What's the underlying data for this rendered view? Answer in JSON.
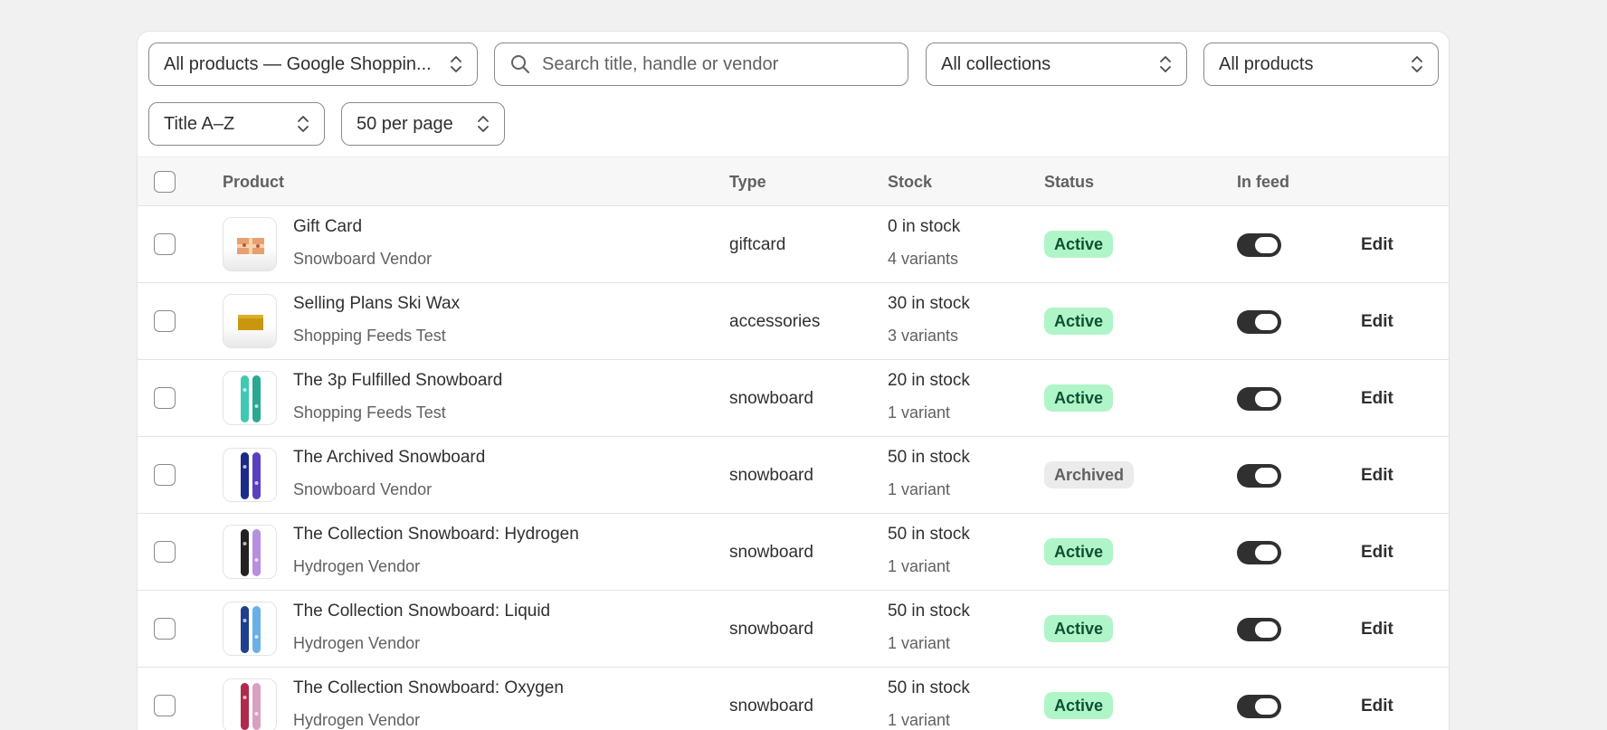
{
  "filters": {
    "feed_select": "All products — Google Shoppin...",
    "search_placeholder": "Search title, handle or vendor",
    "collections_select": "All collections",
    "products_select": "All products",
    "sort_select": "Title A–Z",
    "per_page_select": "50 per page"
  },
  "table": {
    "headers": {
      "product": "Product",
      "type": "Type",
      "stock": "Stock",
      "status": "Status",
      "in_feed": "In feed"
    },
    "edit_label": "Edit",
    "rows": [
      {
        "name": "Gift Card",
        "vendor": "Snowboard Vendor",
        "type": "giftcard",
        "stock": "0 in stock",
        "variants": "4 variants",
        "status": "Active",
        "in_feed": true,
        "thumb_icon": "gift-card-icon"
      },
      {
        "name": "Selling Plans Ski Wax",
        "vendor": "Shopping Feeds Test",
        "type": "accessories",
        "stock": "30 in stock",
        "variants": "3 variants",
        "status": "Active",
        "in_feed": true,
        "thumb_icon": "ski-wax-icon"
      },
      {
        "name": "The 3p Fulfilled Snowboard",
        "vendor": "Shopping Feeds Test",
        "type": "snowboard",
        "stock": "20 in stock",
        "variants": "1 variant",
        "status": "Active",
        "in_feed": true,
        "thumb_icon": "snowboard-icon"
      },
      {
        "name": "The Archived Snowboard",
        "vendor": "Snowboard Vendor",
        "type": "snowboard",
        "stock": "50 in stock",
        "variants": "1 variant",
        "status": "Archived",
        "in_feed": true,
        "thumb_icon": "snowboard-icon"
      },
      {
        "name": "The Collection Snowboard: Hydrogen",
        "vendor": "Hydrogen Vendor",
        "type": "snowboard",
        "stock": "50 in stock",
        "variants": "1 variant",
        "status": "Active",
        "in_feed": true,
        "thumb_icon": "snowboard-icon"
      },
      {
        "name": "The Collection Snowboard: Liquid",
        "vendor": "Hydrogen Vendor",
        "type": "snowboard",
        "stock": "50 in stock",
        "variants": "1 variant",
        "status": "Active",
        "in_feed": true,
        "thumb_icon": "snowboard-icon"
      },
      {
        "name": "The Collection Snowboard: Oxygen",
        "vendor": "Hydrogen Vendor",
        "type": "snowboard",
        "stock": "50 in stock",
        "variants": "1 variant",
        "status": "Active",
        "in_feed": true,
        "thumb_icon": "snowboard-icon"
      }
    ]
  },
  "colors": {
    "active_badge_bg": "#aff5c8",
    "active_badge_text": "#0c5132",
    "archived_badge_bg": "#ebebeb",
    "toggle_on": "#303030"
  }
}
